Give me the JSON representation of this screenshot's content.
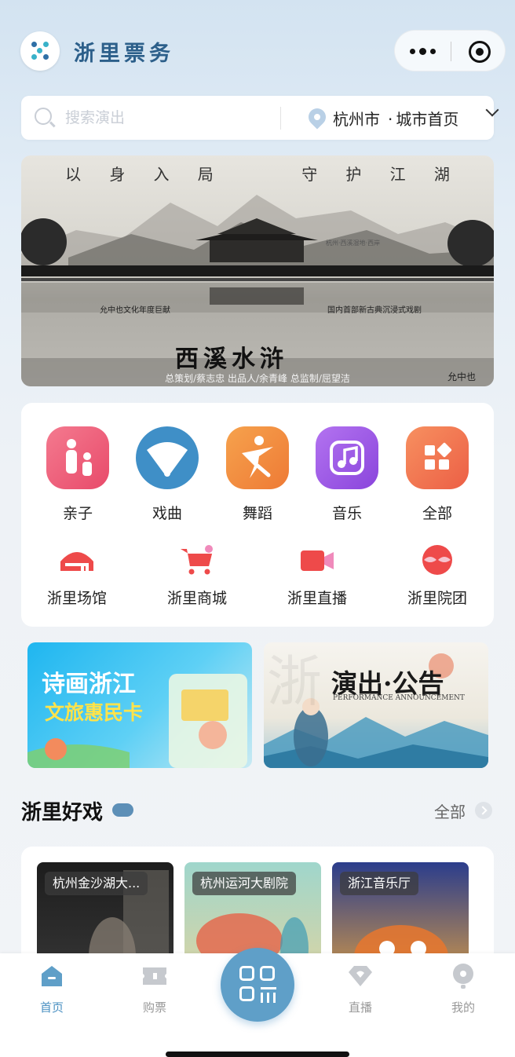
{
  "header": {
    "brand": "浙里票务"
  },
  "search": {
    "placeholder": "搜索演出",
    "city": "杭州市",
    "separator": "·",
    "city_page": "城市首页"
  },
  "banner": {
    "motto": [
      "以",
      "身",
      "入",
      "局",
      "守",
      "护",
      "江",
      "湖"
    ],
    "subtitle_left": "允中也文化年度巨献",
    "subtitle_right": "国内首部新古典沉浸式戏剧",
    "small_tag": "杭州·西溪湿地·西岸",
    "title": "西溪水浒",
    "credits": "总策划/蔡志忠 出品人/余青峰 总监制/屈望洁",
    "brand_mark": "允中也"
  },
  "categories": [
    {
      "label": "亲子",
      "icon": "parent-child-icon",
      "color": "#ef5a78"
    },
    {
      "label": "戏曲",
      "icon": "opera-fan-icon",
      "color": "#3f8fc7"
    },
    {
      "label": "舞蹈",
      "icon": "dance-icon",
      "color": "#f08a3c"
    },
    {
      "label": "音乐",
      "icon": "music-icon",
      "color": "#9a55e6"
    },
    {
      "label": "全部",
      "icon": "all-grid-icon",
      "color": "#f0744c"
    }
  ],
  "services": [
    {
      "label": "浙里场馆",
      "icon": "venue-icon"
    },
    {
      "label": "浙里商城",
      "icon": "shopping-cart-icon"
    },
    {
      "label": "浙里直播",
      "icon": "live-camera-icon"
    },
    {
      "label": "浙里院团",
      "icon": "troupe-mask-icon"
    }
  ],
  "promos": [
    {
      "title": "诗画浙江",
      "subtitle": "文旅惠民卡"
    },
    {
      "title": "演出·公告",
      "subtitle": "PERFORMANCE ANNOUNCEMENT"
    }
  ],
  "section": {
    "title": "浙里好戏",
    "more": "全部"
  },
  "venues": [
    {
      "name": "杭州金沙湖大..."
    },
    {
      "name": "杭州运河大剧院"
    },
    {
      "name": "浙江音乐厅"
    }
  ],
  "tabs": [
    {
      "label": "首页",
      "icon": "home-icon",
      "active": true
    },
    {
      "label": "购票",
      "icon": "ticket-icon",
      "active": false
    },
    {
      "label": "直播",
      "icon": "live-diamond-icon",
      "active": false
    },
    {
      "label": "我的",
      "icon": "profile-icon",
      "active": false
    }
  ],
  "colors": {
    "primary": "#4a90c2",
    "brand": "#2c5f8a",
    "background": "#eef2f6"
  }
}
